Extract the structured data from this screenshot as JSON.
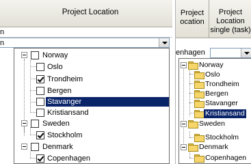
{
  "left": {
    "header": "Project Location",
    "row_text": "n",
    "combo_text": "n",
    "tree": {
      "norway": {
        "label": "Norway",
        "checked": false
      },
      "oslo": {
        "label": "Oslo",
        "checked": false
      },
      "trondheim": {
        "label": "Trondheim",
        "checked": true
      },
      "bergen": {
        "label": "Bergen",
        "checked": false
      },
      "stavanger": {
        "label": "Stavanger",
        "checked": false,
        "selected": true
      },
      "kristiansand": {
        "label": "Kristiansand",
        "checked": false
      },
      "sweden": {
        "label": "Sweden",
        "checked": false
      },
      "stockholm": {
        "label": "Stockholm",
        "checked": true
      },
      "denmark": {
        "label": "Denmark",
        "checked": false
      },
      "copenhagen": {
        "label": "Copenhagen",
        "checked": true
      }
    }
  },
  "right": {
    "header_col1": [
      "Project",
      "ocation"
    ],
    "header_col2": [
      "Project",
      "Location",
      "single (task)"
    ],
    "row_text": "enhagen",
    "tree": {
      "norway": "Norway",
      "oslo": "Oslo",
      "trondheim": "Trondheim",
      "bergen": "Bergen",
      "stavanger": "Stavanger",
      "kristiansand": "Kristiansand",
      "sweden": "Sweden",
      "stockholm": "Stockholm",
      "denmark": "Denmark",
      "copenhagen": "Copenhagen"
    },
    "selected": "kristiansand"
  },
  "colors": {
    "selection": "#0a246a",
    "folder": "#f6d66b"
  }
}
